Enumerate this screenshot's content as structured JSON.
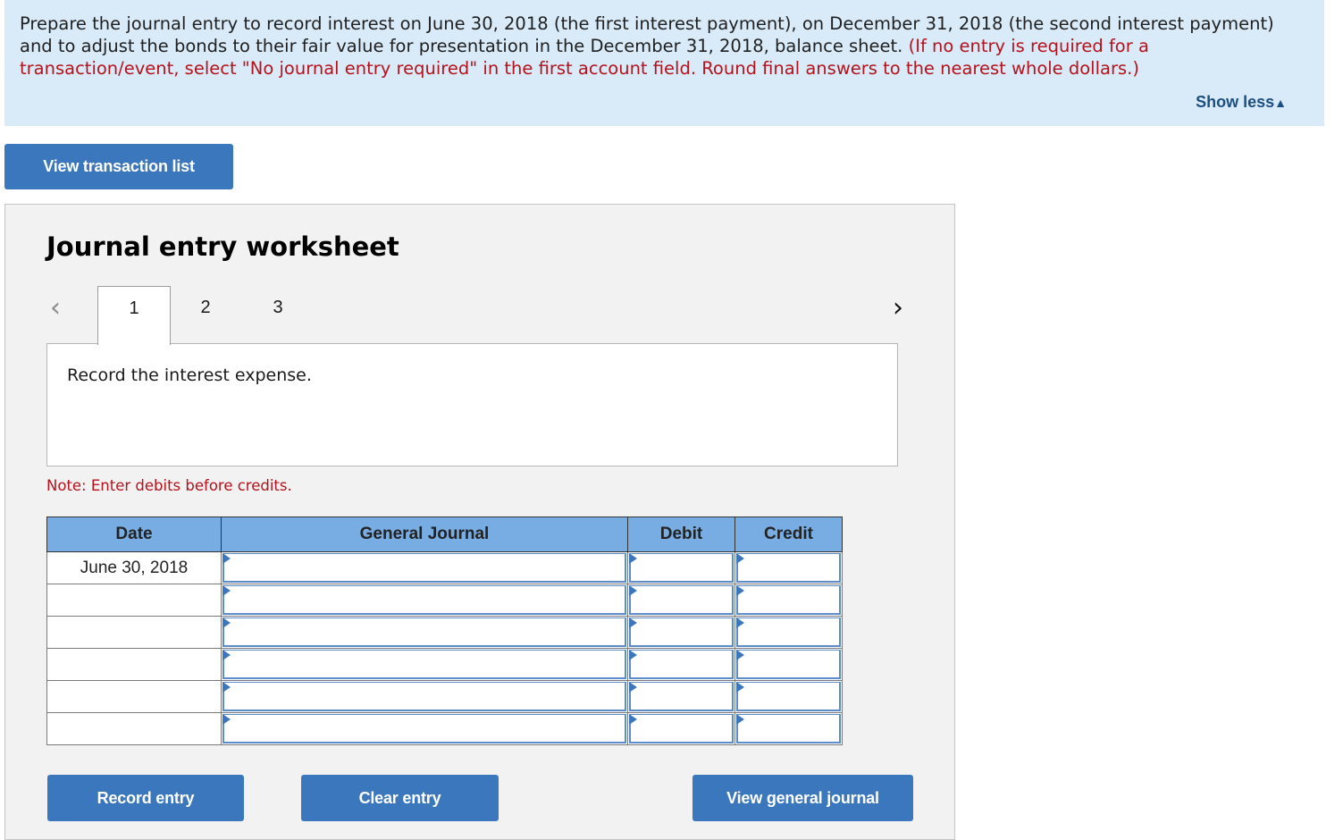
{
  "prompt": {
    "text_main": "Prepare the journal entry to record interest on June 30, 2018 (the first interest payment), on December 31, 2018 (the second interest payment) and to adjust the bonds to their fair value for presentation in the December 31, 2018, balance sheet.",
    "text_instruction": "(If no entry is required for a transaction/event, select \"No journal entry required\" in the first account field. Round final answers to the nearest whole dollars.)",
    "show_less_label": "Show less",
    "show_less_icon": "▲"
  },
  "buttons": {
    "view_transaction_list": "View transaction list",
    "record_entry": "Record entry",
    "clear_entry": "Clear entry",
    "view_general_journal": "View general journal"
  },
  "worksheet": {
    "title": "Journal entry worksheet",
    "prev_icon": "‹",
    "next_icon": "›",
    "tabs": [
      {
        "label": "1",
        "active": true
      },
      {
        "label": "2",
        "active": false
      },
      {
        "label": "3",
        "active": false
      }
    ],
    "instruction": "Record the interest expense.",
    "note": "Note: Enter debits before credits."
  },
  "table": {
    "headers": {
      "date": "Date",
      "general_journal": "General Journal",
      "debit": "Debit",
      "credit": "Credit"
    },
    "rows": [
      {
        "date": "June 30, 2018",
        "account": "",
        "debit": "",
        "credit": ""
      },
      {
        "date": "",
        "account": "",
        "debit": "",
        "credit": ""
      },
      {
        "date": "",
        "account": "",
        "debit": "",
        "credit": ""
      },
      {
        "date": "",
        "account": "",
        "debit": "",
        "credit": ""
      },
      {
        "date": "",
        "account": "",
        "debit": "",
        "credit": ""
      },
      {
        "date": "",
        "account": "",
        "debit": "",
        "credit": ""
      }
    ]
  }
}
